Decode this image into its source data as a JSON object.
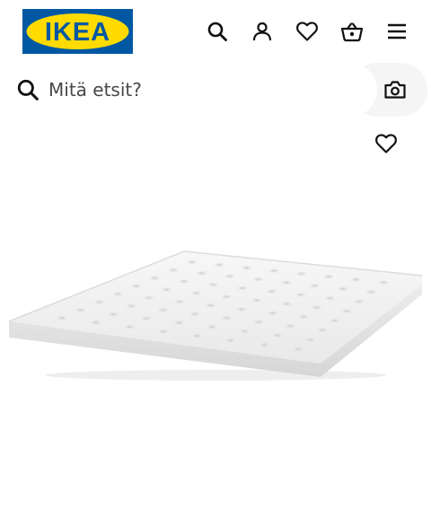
{
  "header": {
    "logo_text": "IKEA",
    "brand_colors": {
      "blue": "#0058a3",
      "yellow": "#ffdb00"
    },
    "icons": [
      "search-icon",
      "profile-icon",
      "heart-icon",
      "shopping-bag-icon",
      "menu-icon"
    ]
  },
  "search": {
    "placeholder": "Mitä etsit?",
    "icon": "search-icon",
    "camera_icon": "camera-icon"
  },
  "product": {
    "favourite_icon": "heart-icon",
    "image_subject": "mattress-topper"
  }
}
